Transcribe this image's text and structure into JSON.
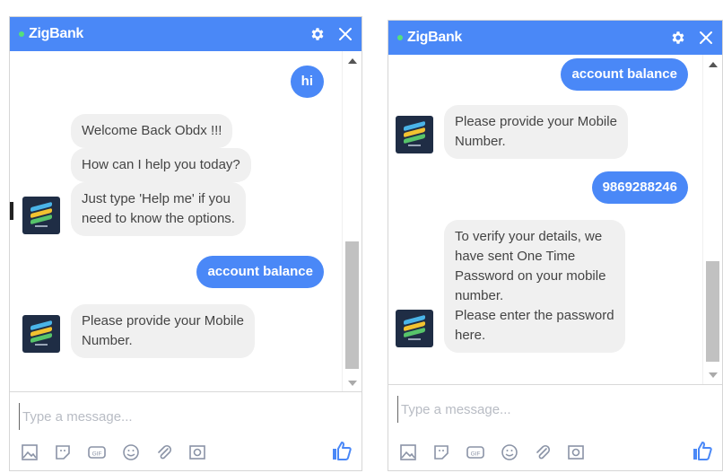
{
  "widgets": [
    {
      "header": {
        "title": "ZigBank",
        "status_icon": "online-dot-icon",
        "settings_icon": "gear-icon",
        "close_icon": "close-icon"
      },
      "messages": [
        {
          "sender": "user",
          "text": "hi"
        },
        {
          "sender": "bot",
          "bubbles": [
            "Welcome Back Obdx !!!",
            "How can I help you today?",
            "Just type 'Help me' if you\nneed to know the options."
          ]
        },
        {
          "sender": "user",
          "text": "account balance"
        },
        {
          "sender": "bot",
          "bubbles": [
            "Please provide your Mobile\nNumber."
          ]
        }
      ],
      "composer": {
        "placeholder": "Type a message...",
        "value": ""
      },
      "tool_icons": [
        "image-icon",
        "sticker-icon",
        "gif-icon",
        "emoji-icon",
        "attachment-icon",
        "camera-icon"
      ],
      "send_icon": "thumbs-up-icon"
    },
    {
      "header": {
        "title": "ZigBank",
        "status_icon": "online-dot-icon",
        "settings_icon": "gear-icon",
        "close_icon": "close-icon"
      },
      "messages": [
        {
          "sender": "user",
          "text": "account balance"
        },
        {
          "sender": "bot",
          "bubbles": [
            "Please provide your Mobile\nNumber."
          ]
        },
        {
          "sender": "user",
          "text": "9869288246"
        },
        {
          "sender": "bot",
          "bubbles": [
            "To verify your details, we\nhave sent One Time\nPassword on your mobile\nnumber.\nPlease enter the password\nhere."
          ]
        }
      ],
      "composer": {
        "placeholder": "Type a message...",
        "value": ""
      },
      "tool_icons": [
        "image-icon",
        "sticker-icon",
        "gif-icon",
        "emoji-icon",
        "attachment-icon",
        "camera-icon"
      ],
      "send_icon": "thumbs-up-icon"
    }
  ],
  "colors": {
    "brand": "#4a88f7",
    "bot_bubble": "#f0f0f0",
    "avatar_bg": "#1f2d45",
    "online": "#55e07a"
  }
}
